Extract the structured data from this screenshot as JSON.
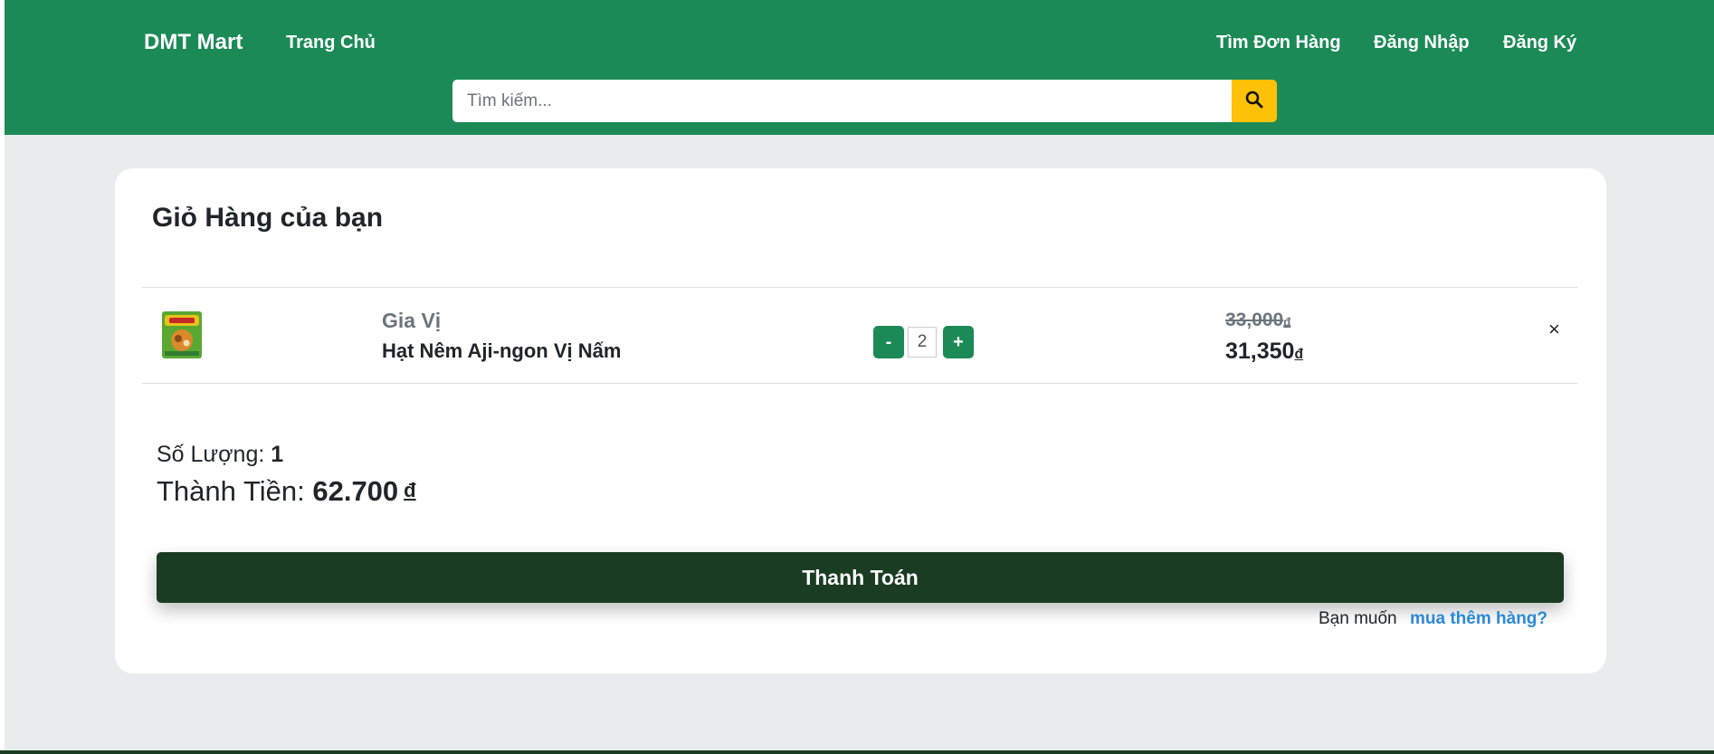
{
  "header": {
    "brand": "DMT Mart",
    "nav": {
      "home": "Trang Chủ",
      "find_order": "Tìm Đơn Hàng",
      "login": "Đăng Nhập",
      "register": "Đăng Ký"
    },
    "search": {
      "placeholder": "Tìm kiếm...",
      "icon": "search-icon"
    }
  },
  "cart": {
    "title": "Giỏ Hàng của bạn",
    "items": [
      {
        "category": "Gia Vị",
        "name": "Hạt Nêm Aji-ngon Vị Nấm",
        "qty_minus": "-",
        "quantity": "2",
        "qty_plus": "+",
        "old_price": "33,000",
        "new_price": "31,350",
        "currency": "đ",
        "remove": "×"
      }
    ],
    "summary": {
      "qty_label": "Số Lượng: ",
      "qty_value": "1",
      "total_label": "Thành Tiền: ",
      "total_value": "62.700",
      "currency": "đ"
    },
    "checkout_label": "Thanh Toán",
    "more_text": "Bạn muốn",
    "more_link": "mua thêm hàng?"
  },
  "colors": {
    "header_bg": "#1b8a56",
    "search_button": "#ffc107",
    "checkout_bg": "#1a3c22",
    "link": "#2b8ad8",
    "page_bg": "#e9ecef"
  }
}
